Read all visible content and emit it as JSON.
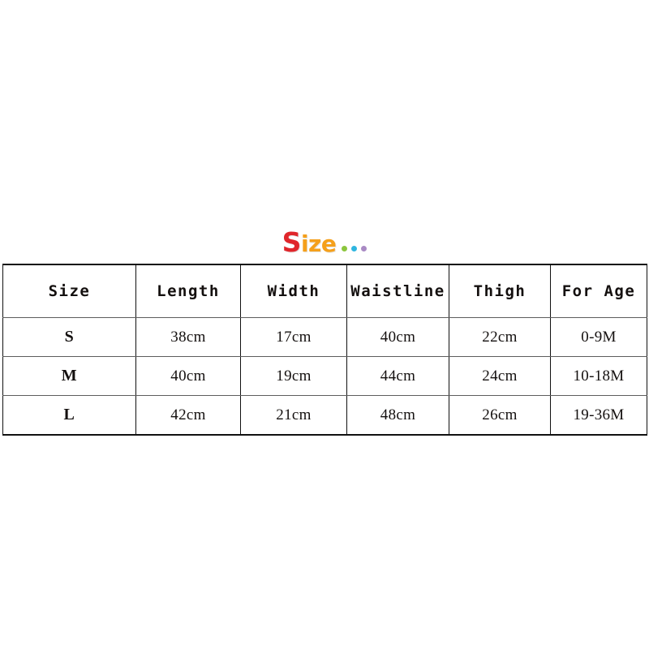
{
  "logo": {
    "first_letter": "S",
    "rest": "ize",
    "first_letter_color": "#e0262b",
    "rest_color": "#f5a01b",
    "dots": [
      {
        "name": "dot-green",
        "color": "#8cc63e"
      },
      {
        "name": "dot-blue",
        "color": "#2fb6e0"
      },
      {
        "name": "dot-purple",
        "color": "#a98ac4"
      }
    ]
  },
  "table": {
    "headers": [
      "Size",
      "Length",
      "Width",
      "Waistline",
      "Thigh",
      "For Age"
    ],
    "rows": [
      {
        "size": "S",
        "length": "38cm",
        "width": "17cm",
        "waistline": "40cm",
        "thigh": "22cm",
        "for_age": "0-9M"
      },
      {
        "size": "M",
        "length": "40cm",
        "width": "19cm",
        "waistline": "44cm",
        "thigh": "24cm",
        "for_age": "10-18M"
      },
      {
        "size": "L",
        "length": "42cm",
        "width": "21cm",
        "waistline": "48cm",
        "thigh": "26cm",
        "for_age": "19-36M"
      }
    ]
  },
  "colors": {
    "background": "#ffffff",
    "border_outer": "#111111",
    "border_inner": "#5d5d5d",
    "text": "#14100f"
  }
}
